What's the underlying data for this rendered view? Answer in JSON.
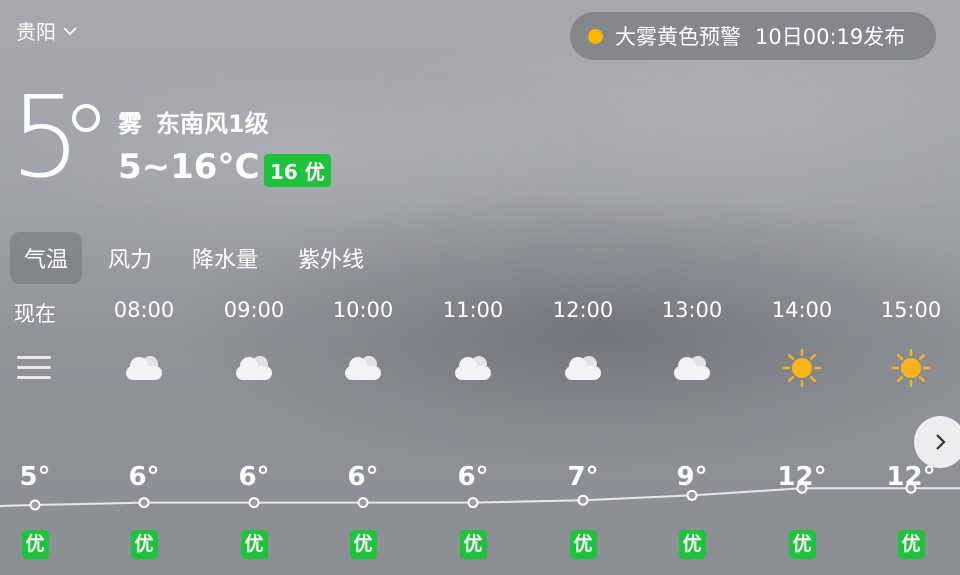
{
  "location": {
    "name": "贵阳"
  },
  "alert": {
    "title": "大雾黄色预警",
    "published": "10日00:19发布",
    "color": "#f5b800"
  },
  "current": {
    "temp": "5",
    "condition": "雾",
    "wind": "东南风1级",
    "range": "5~16°C",
    "aqi": "16 优",
    "aqi_color": "#1ec33c"
  },
  "tabs": [
    {
      "label": "气温",
      "active": true
    },
    {
      "label": "风力",
      "active": false
    },
    {
      "label": "降水量",
      "active": false
    },
    {
      "label": "紫外线",
      "active": false
    }
  ],
  "hourly": [
    {
      "time": "现在",
      "icon": "fog-icon",
      "temp": "5°",
      "value": 5,
      "aqi": "优"
    },
    {
      "time": "08:00",
      "icon": "cloudy-icon",
      "temp": "6°",
      "value": 6,
      "aqi": "优"
    },
    {
      "time": "09:00",
      "icon": "cloudy-icon",
      "temp": "6°",
      "value": 6,
      "aqi": "优"
    },
    {
      "time": "10:00",
      "icon": "cloudy-icon",
      "temp": "6°",
      "value": 6,
      "aqi": "优"
    },
    {
      "time": "11:00",
      "icon": "cloudy-icon",
      "temp": "6°",
      "value": 6,
      "aqi": "优"
    },
    {
      "time": "12:00",
      "icon": "cloudy-icon",
      "temp": "7°",
      "value": 7,
      "aqi": "优"
    },
    {
      "time": "13:00",
      "icon": "cloudy-icon",
      "temp": "9°",
      "value": 9,
      "aqi": "优"
    },
    {
      "time": "14:00",
      "icon": "sunny-icon",
      "temp": "12°",
      "value": 12,
      "aqi": "优"
    },
    {
      "time": "15:00",
      "icon": "sunny-icon",
      "temp": "12°",
      "value": 12,
      "aqi": "优"
    }
  ],
  "colors": {
    "aqi_good": "#1ec33c",
    "sun": "#f9b31a",
    "line": "#e6e7ea"
  }
}
